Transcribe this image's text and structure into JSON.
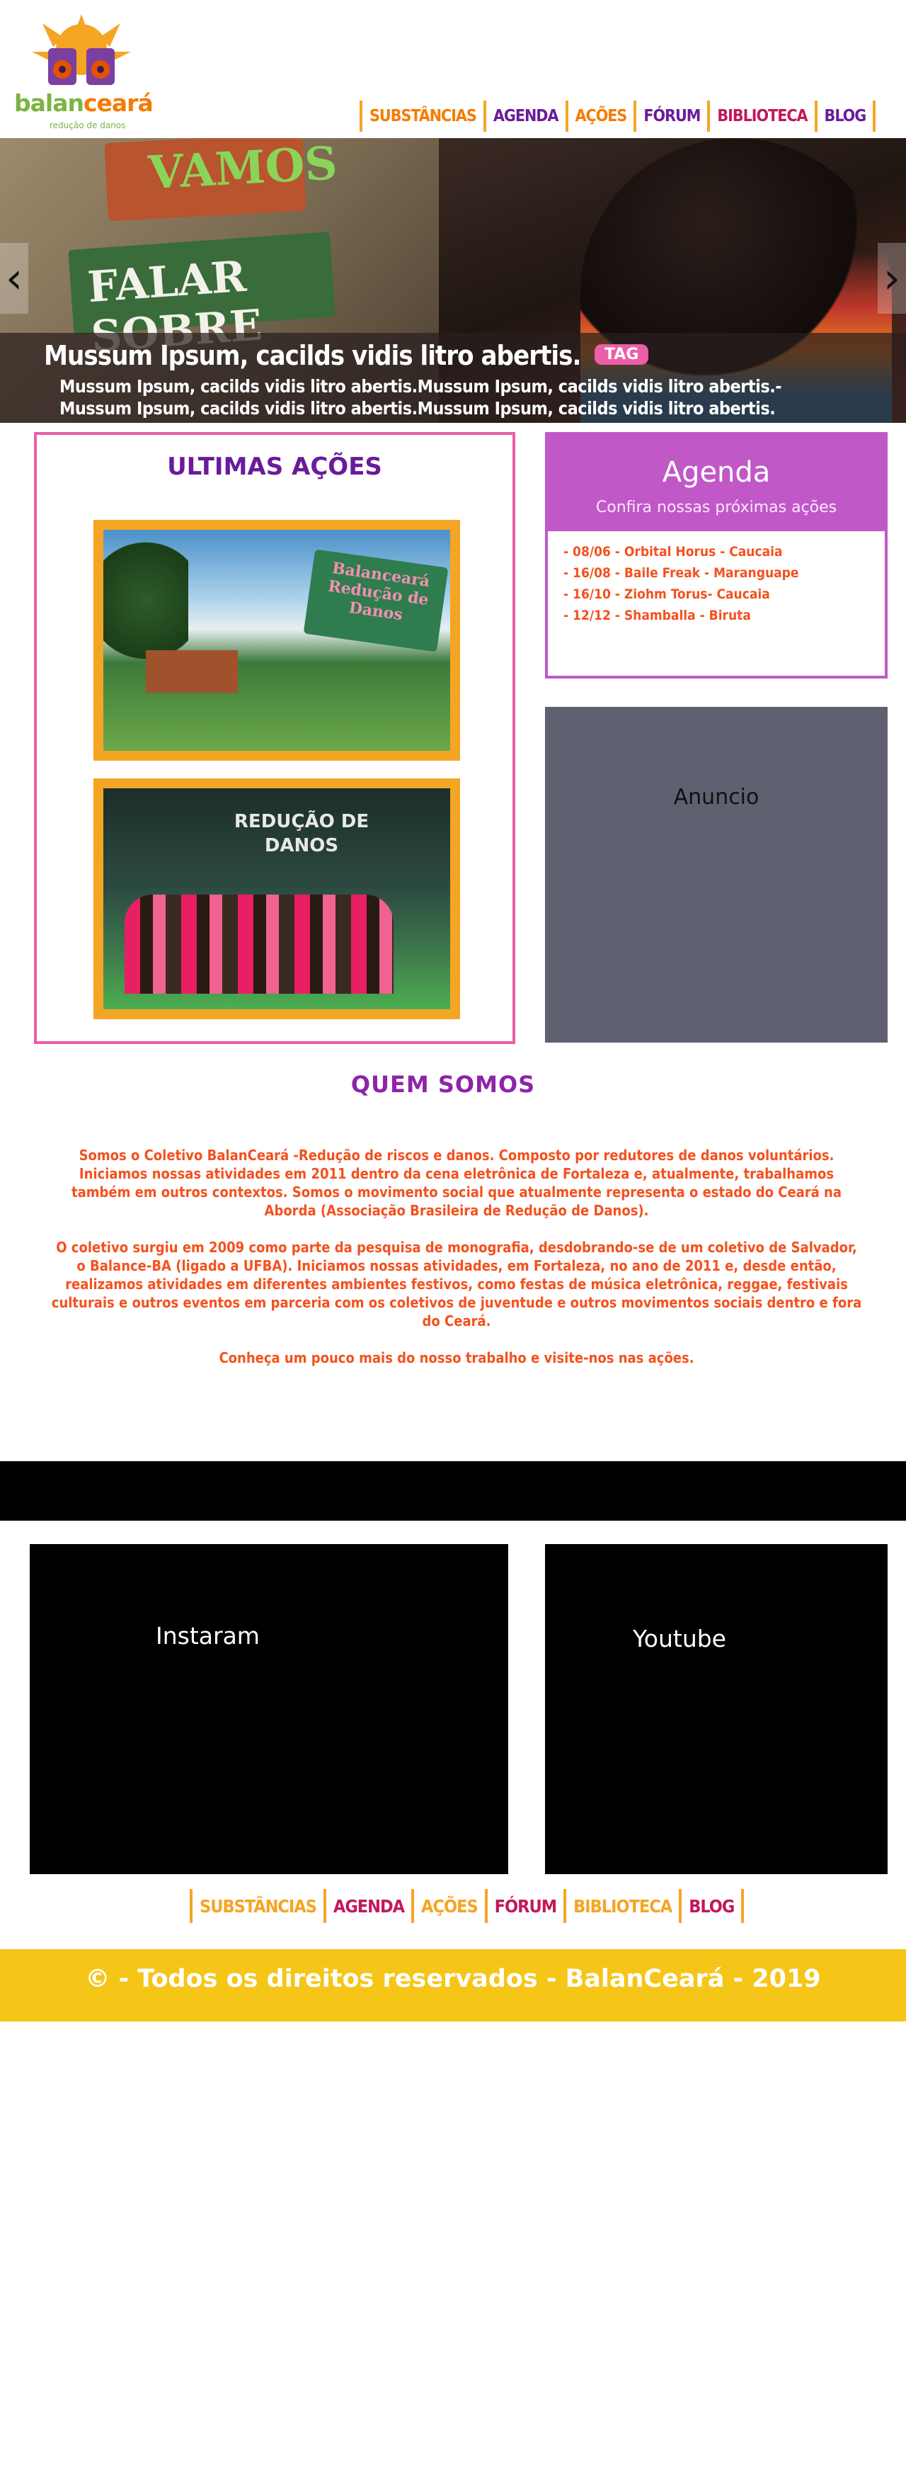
{
  "brand": {
    "name_part1": "balan",
    "name_part2": "ceará",
    "tagline": "redução de danos"
  },
  "nav": {
    "items": [
      {
        "label": "SUBSTÂNCIAS",
        "color": "#f57c00"
      },
      {
        "label": "AGENDA",
        "color": "#6a1b9a"
      },
      {
        "label": "AÇÕES",
        "color": "#f57c00"
      },
      {
        "label": "FÓRUM",
        "color": "#6a1b9a"
      },
      {
        "label": "BIBLIOTECA",
        "color": "#c2185b"
      },
      {
        "label": "BLOG",
        "color": "#6a1b9a"
      }
    ]
  },
  "hero": {
    "sign_top": "VAMOS",
    "sign_bottom": "FALAR SOBRE",
    "title": "Mussum Ipsum, cacilds vidis litro abertis.",
    "tag": "TAG",
    "text": "Mussum Ipsum, cacilds vidis litro abertis.Mussum Ipsum, cacilds vidis litro abertis.- Mussum Ipsum, cacilds vidis litro abertis.Mussum Ipsum, cacilds vidis litro abertis.",
    "prev_icon": "‹",
    "next_icon": "›"
  },
  "ultimas": {
    "title": "ULTIMAS AÇÕES",
    "photo1_sign": "Balanceará Redução de Danos",
    "photo2_banner": "REDUÇÃO DE DANOS"
  },
  "agenda": {
    "title": "Agenda",
    "subtitle": "Confira nossas próximas ações",
    "events": [
      "- 08/06 - Orbital Horus - Caucaia",
      "- 16/08 - Baile Freak - Maranguape",
      "- 16/10 - Ziohm Torus- Caucaia",
      "- 12/12 - Shamballa - Biruta"
    ]
  },
  "anuncio": {
    "label": "Anuncio"
  },
  "quem_somos": {
    "title": "QUEM SOMOS",
    "p1": "Somos o Coletivo BalanCeará -Redução de riscos e danos. Composto por redutores de danos voluntários. Iniciamos nossas atividades em 2011 dentro da cena eletrônica de Fortaleza e, atualmente, trabalhamos também em outros contextos. Somos o movimento social que atualmente representa o estado do Ceará na Aborda (Associação Brasileira de Redução de Danos).",
    "p2": "O coletivo surgiu em 2009 como parte da pesquisa de monografia, desdobrando-se de um coletivo de Salvador, o Balance-BA (ligado a UFBA). Iniciamos nossas atividades, em Fortaleza, no ano de 2011 e, desde então, realizamos atividades em diferentes ambientes festivos, como festas de música eletrônica, reggae, festivais culturais e outros eventos em parceria com os coletivos de juventude e outros movimentos sociais dentro e fora do Ceará.",
    "p3": "Conheça um pouco mais do nosso trabalho e visite-nos nas ações."
  },
  "social": {
    "instagram": "Instaram",
    "youtube": "Youtube"
  },
  "footer_nav": {
    "items": [
      {
        "label": "SUBSTÂNCIAS",
        "color": "#f5a524"
      },
      {
        "label": "AGENDA",
        "color": "#c2185b"
      },
      {
        "label": "AÇÕES",
        "color": "#f5a524"
      },
      {
        "label": "FÓRUM",
        "color": "#c2185b"
      },
      {
        "label": "BIBLIOTECA",
        "color": "#f5a524"
      },
      {
        "label": "BLOG",
        "color": "#c2185b"
      }
    ]
  },
  "copyright": "© - Todos os direitos reservados - BalanCeará - 2019"
}
